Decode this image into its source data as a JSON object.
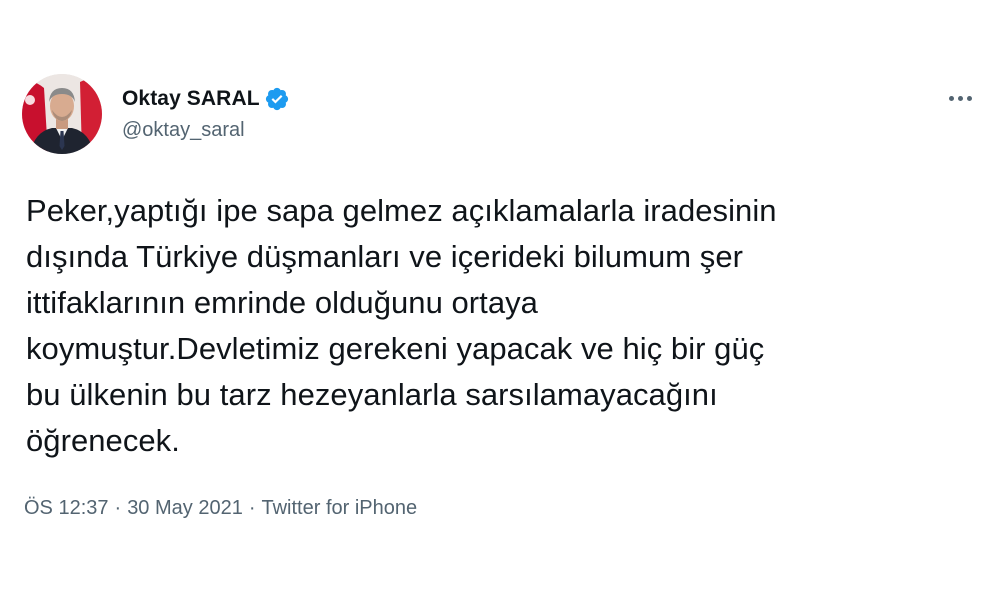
{
  "author": {
    "display_name": "Oktay SARAL",
    "handle": "@oktay_saral",
    "verified": true
  },
  "tweet": {
    "text": "Peker,yaptığı ipe sapa gelmez açıklamalarla iradesinin\ndışında Türkiye düşmanları ve içerideki bilumum şer\nittifaklarının emrinde olduğunu ortaya\nkoymuştur.Devletimiz gerekeni yapacak ve hiç bir güç\nbu ülkenin bu tarz hezeyanlarla sarsılamayacağını\nöğrenecek."
  },
  "meta": {
    "time": "ÖS 12:37",
    "separator": "·",
    "date": "30 May 2021",
    "source": "Twitter for iPhone"
  },
  "icons": {
    "verified": "verified-badge-icon",
    "more": "more-options-icon"
  },
  "colors": {
    "verified_blue": "#1d9bf0",
    "text": "#0f1419",
    "secondary": "#536471"
  }
}
